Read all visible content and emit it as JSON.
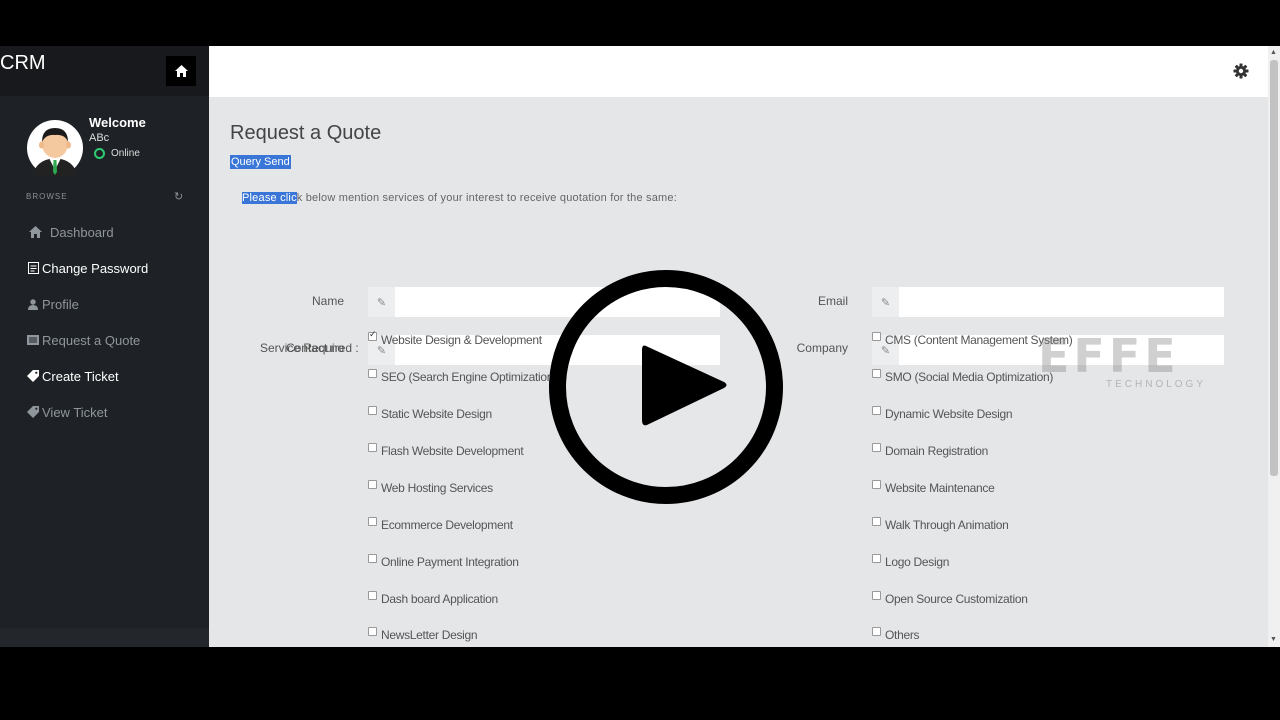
{
  "sidebar": {
    "brand": "CRM",
    "welcome": "Welcome",
    "username": "ABc",
    "status": "Online",
    "browse_label": "BROWSE",
    "items": [
      {
        "label": "Dashboard",
        "icon": "home-icon"
      },
      {
        "label": "Change Password",
        "icon": "document-icon"
      },
      {
        "label": "Profile",
        "icon": "user-icon"
      },
      {
        "label": "Request a Quote",
        "icon": "list-icon"
      },
      {
        "label": "Create Ticket",
        "icon": "ticket-icon"
      },
      {
        "label": "View Ticket",
        "icon": "ticket-icon"
      }
    ]
  },
  "header": {
    "settings_icon": "gear-icon"
  },
  "main": {
    "title": "Request a Quote",
    "query_send": "Query Send",
    "intro_highlight": "Please clic",
    "intro_rest": "k below mention services of your interest to receive quotation for the same:",
    "fields": {
      "name_label": "Name",
      "email_label": "Email",
      "contact_label": "Contact no",
      "company_label": "Company",
      "name_value": "",
      "email_value": "",
      "contact_value": "",
      "company_value": ""
    },
    "service_label": "Service Required :",
    "services_left": [
      {
        "label": "Website Design & Development",
        "checked": true
      },
      {
        "label": "SEO (Search Engine Optimization)",
        "checked": false
      },
      {
        "label": "Static Website Design",
        "checked": false
      },
      {
        "label": "Flash Website Development",
        "checked": false
      },
      {
        "label": "Web Hosting Services",
        "checked": false
      },
      {
        "label": "Ecommerce Development",
        "checked": false
      },
      {
        "label": "Online Payment Integration",
        "checked": false
      },
      {
        "label": "Dash board Application",
        "checked": false
      },
      {
        "label": "NewsLetter Design",
        "checked": false
      }
    ],
    "services_right": [
      {
        "label": "CMS (Content Management System)",
        "checked": false
      },
      {
        "label": "SMO (Social Media Optimization)",
        "checked": false
      },
      {
        "label": "Dynamic Website Design",
        "checked": false
      },
      {
        "label": "Domain Registration",
        "checked": false
      },
      {
        "label": "Website Maintenance",
        "checked": false
      },
      {
        "label": "Walk Through Animation",
        "checked": false
      },
      {
        "label": "Logo Design",
        "checked": false
      },
      {
        "label": "Open Source Customization",
        "checked": false
      },
      {
        "label": "Others",
        "checked": false
      }
    ]
  },
  "watermark": {
    "brand": "EFFE",
    "tagline": "TECHNOLOGY"
  },
  "overlay": {
    "icon": "play-icon"
  }
}
